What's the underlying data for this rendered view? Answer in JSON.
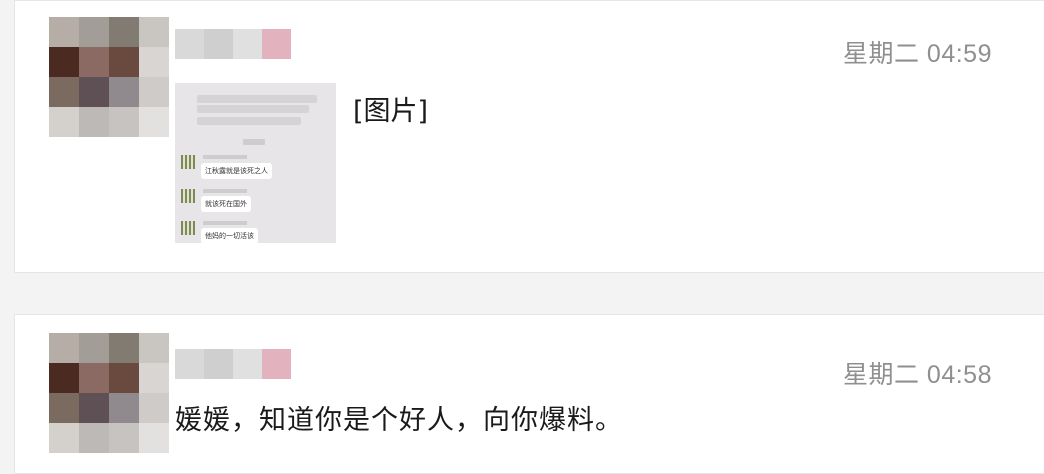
{
  "messages": [
    {
      "time": "星期二 04:59",
      "preview_label": "[图片]",
      "thumbnail": {
        "bubbles": [
          "江秋露就是该死之人",
          "就该死在国外",
          "他妈的一切活该"
        ]
      }
    },
    {
      "time": "星期二 04:58",
      "text": "媛媛，知道你是个好人，向你爆料。"
    }
  ],
  "avatar_mosaic": [
    "#b6aea6",
    "#a39d98",
    "#827b71",
    "#c9c6c2",
    "#4b2a22",
    "#8c6a64",
    "#6a4a3e",
    "#d8d5d2",
    "#7b6a60",
    "#5e5054",
    "#908a8e",
    "#cfcbc8",
    "#d4d0cb",
    "#bdb9b6",
    "#c6c3c1",
    "#e3e1df"
  ],
  "name_mosaic": [
    "#d9d9d9",
    "#cfcfcf",
    "#e0e0e0",
    "#e2b3bf"
  ]
}
